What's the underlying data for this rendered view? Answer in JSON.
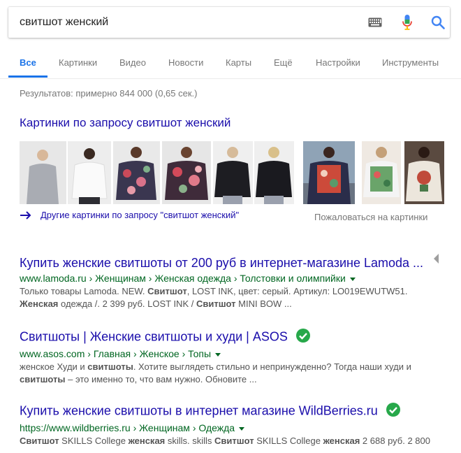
{
  "search": {
    "query": "свитшот женский"
  },
  "tabs": [
    {
      "label": "Все",
      "active": true
    },
    {
      "label": "Картинки"
    },
    {
      "label": "Видео"
    },
    {
      "label": "Новости"
    },
    {
      "label": "Карты"
    },
    {
      "label": "Ещё"
    },
    {
      "label": "Настройки"
    },
    {
      "label": "Инструменты"
    }
  ],
  "stats": "Результатов: примерно 844 000 (0,65 сек.)",
  "images": {
    "heading": "Картинки по запросу свитшот женский",
    "more_link": "Другие картинки по запросу \"свитшот женский\"",
    "report": "Пожаловаться на картинки",
    "thumbs": [
      {
        "icon": "grey-sweatshirt-photo",
        "color": "#a9acb3"
      },
      {
        "icon": "white-sweatshirt-photo",
        "color": "#f2f2f2"
      },
      {
        "icon": "floral-sweatshirt-photo",
        "color": "#3a3650"
      },
      {
        "icon": "floral-red-sweatshirt-photo",
        "color": "#3f2b3a"
      },
      {
        "icon": "black-sweatshirt-photo",
        "color": "#1d1d22"
      },
      {
        "icon": "black-sweatshirt-back-photo",
        "color": "#1a1a1f"
      },
      {
        "icon": "printed-sweatshirt-photo",
        "color": "#cc4a3a"
      },
      {
        "icon": "green-print-sweatshirt-photo",
        "color": "#6aa46a"
      },
      {
        "icon": "white-print-sweatshirt-photo",
        "color": "#ece6dc"
      }
    ]
  },
  "results": [
    {
      "title": "Купить женские свитшоты от 200 руб в интернет-магазине Lamoda ...",
      "url_parts": [
        "www.lamoda.ru",
        "Женщинам",
        "Женская одежда",
        "Толстовки и олимпийки"
      ],
      "snippet_lines": [
        [
          [
            "Только товары Lamoda. NEW. ",
            false
          ],
          [
            "Свитшот",
            true
          ],
          [
            ", LOST INK, цвет: серый. Артикул: LO019EWUTW51.",
            false
          ]
        ],
        [
          [
            "Женская",
            true
          ],
          [
            " одежда /. 2 399 руб. LOST INK / ",
            false
          ],
          [
            "Свитшот",
            true
          ],
          [
            " MINI BOW ...",
            false
          ]
        ]
      ],
      "verified": false
    },
    {
      "title": "Свитшоты | Женские свитшоты и худи | ASOS",
      "url_parts": [
        "www.asos.com",
        "Главная",
        "Женское",
        "Топы"
      ],
      "snippet_lines": [
        [
          [
            "женское Худи и ",
            false
          ],
          [
            "свитшоты",
            true
          ],
          [
            ". Хотите выглядеть стильно и непринужденно? Тогда наши худи и",
            false
          ]
        ],
        [
          [
            "свитшоты",
            true
          ],
          [
            " – это именно то, что вам нужно. Обновите ...",
            false
          ]
        ]
      ],
      "verified": true
    },
    {
      "title": "Купить женские свитшоты в интернет магазине WildBerries.ru",
      "url_parts": [
        "https://www.wildberries.ru",
        "Женщинам",
        "Одежда"
      ],
      "snippet_lines": [
        [
          [
            "Свитшот",
            true
          ],
          [
            " SKILLS College ",
            false
          ],
          [
            "женская",
            true
          ],
          [
            " skills. skills ",
            false
          ],
          [
            "Свитшот",
            true
          ],
          [
            " SKILLS College ",
            false
          ],
          [
            "женская",
            true
          ],
          [
            " 2 688 руб. 2 800",
            false
          ]
        ]
      ],
      "verified": true
    }
  ],
  "colors": {
    "link": "#1a0dab",
    "url_green": "#006621",
    "accent": "#1a73e8",
    "verified_green": "#27a84a"
  }
}
